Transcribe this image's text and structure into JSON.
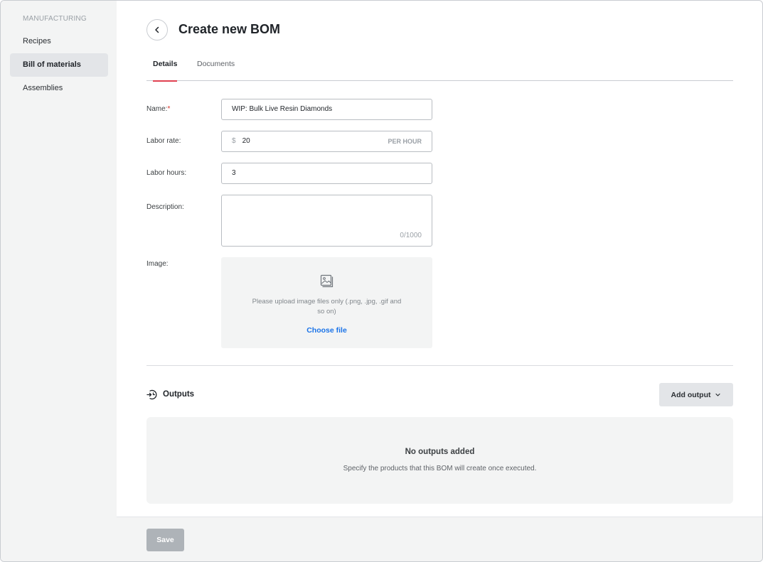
{
  "sidebar": {
    "heading": "MANUFACTURING",
    "items": [
      {
        "label": "Recipes"
      },
      {
        "label": "Bill of materials"
      },
      {
        "label": "Assemblies"
      }
    ]
  },
  "header": {
    "title": "Create new BOM",
    "back_icon": "chevron-left-icon"
  },
  "tabs": [
    {
      "label": "Details",
      "active": true
    },
    {
      "label": "Documents",
      "active": false
    }
  ],
  "form": {
    "name": {
      "label": "Name:",
      "required_mark": "*",
      "value": "WIP: Bulk Live Resin Diamonds"
    },
    "labor_rate": {
      "label": "Labor rate:",
      "prefix": "$",
      "value": "20",
      "suffix": "PER HOUR"
    },
    "labor_hours": {
      "label": "Labor hours:",
      "value": "3"
    },
    "description": {
      "label": "Description:",
      "value": "",
      "char_count": "0/1000"
    },
    "image": {
      "label": "Image:",
      "icon": "image-icon",
      "hint": "Please upload image files only (.png, .jpg, .gif and so on)",
      "choose_label": "Choose file"
    }
  },
  "outputs": {
    "icon": "output-icon",
    "title": "Outputs",
    "add_button_label": "Add output",
    "empty_title": "No outputs added",
    "empty_description": "Specify the products that this BOM will create once executed."
  },
  "footer": {
    "save_label": "Save"
  },
  "colors": {
    "active_tab_underline": "#e04050",
    "link": "#1a73e8",
    "required": "#d93025",
    "save_disabled": "#aeb3b8"
  }
}
